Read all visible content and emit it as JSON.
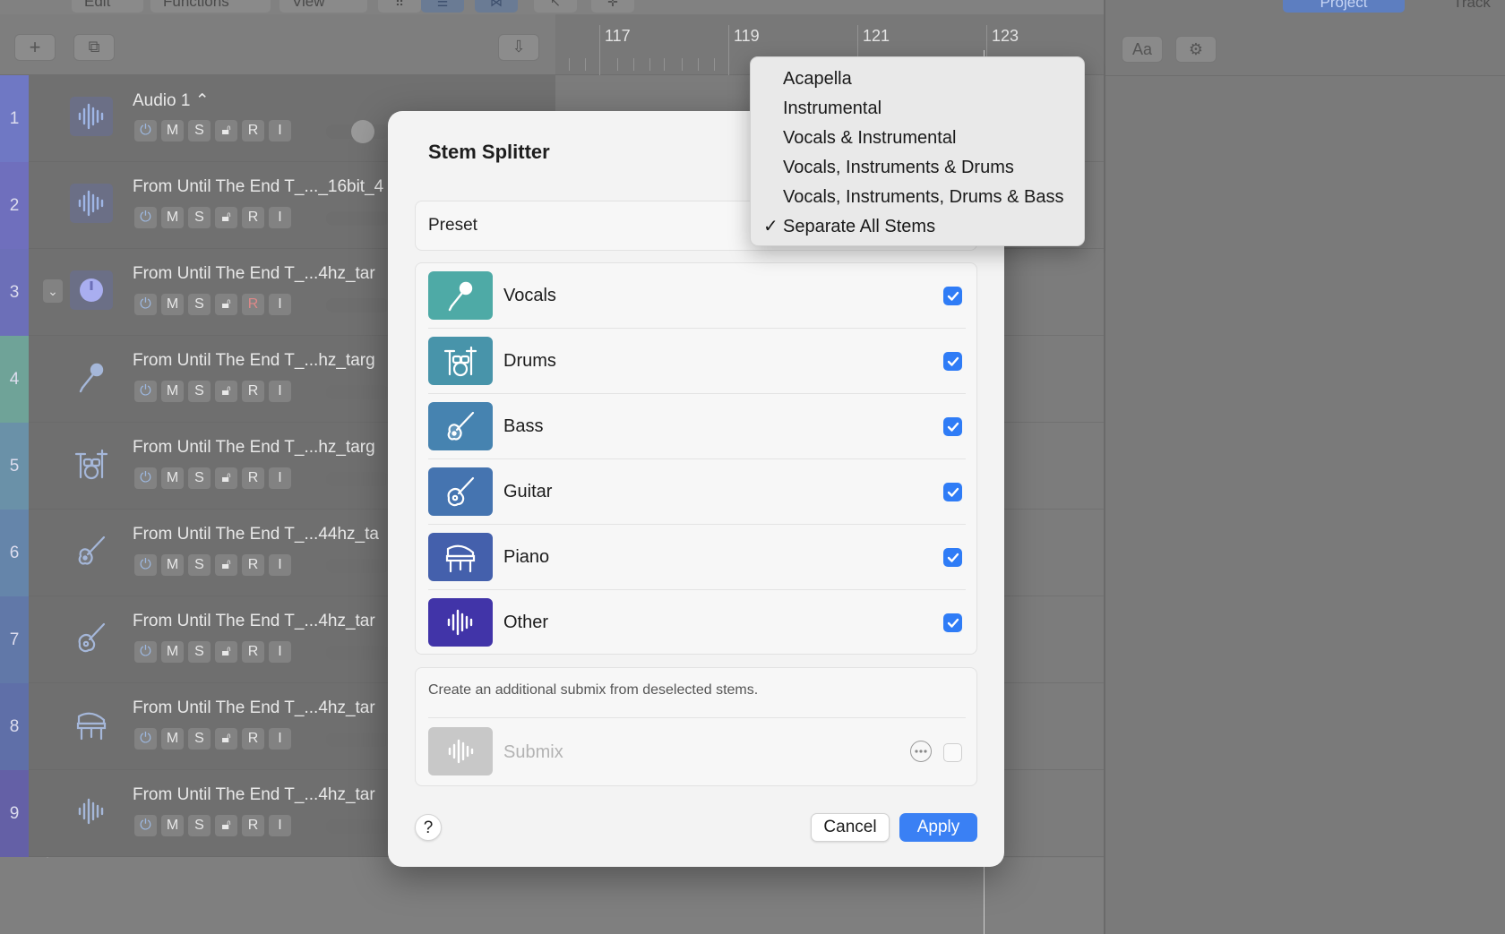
{
  "app": {
    "menubar": [
      "Edit",
      "Functions",
      "View"
    ],
    "ruler": [
      "117",
      "119",
      "121",
      "123"
    ],
    "sidebar_tabs": [
      "Project",
      "Track"
    ],
    "sidebar_font_button": "Aa",
    "tracks": [
      {
        "num": "1",
        "name": "Audio 1 ⌃",
        "color": "#6f78c4",
        "icon": "waveform-icon"
      },
      {
        "num": "2",
        "name": "From Until The End T_..._16bit_4",
        "color": "#6f6fbd",
        "icon": "waveform-icon"
      },
      {
        "num": "3",
        "name": "From Until The End T_...4hz_tar",
        "color": "#6c6fb8",
        "icon": "stem-splitter-icon"
      },
      {
        "num": "4",
        "name": "From Until The End T_...hz_targ",
        "color": "#6fa398",
        "icon": "microphone-icon"
      },
      {
        "num": "5",
        "name": "From Until The End T_...hz_targ",
        "color": "#6a91a8",
        "icon": "drums-icon"
      },
      {
        "num": "6",
        "name": "From Until The End T_...44hz_ta",
        "color": "#6585aa",
        "icon": "bass-guitar-icon"
      },
      {
        "num": "7",
        "name": "From Until The End T_...4hz_tar",
        "color": "#6178a8",
        "icon": "guitar-icon"
      },
      {
        "num": "8",
        "name": "From Until The End T_...4hz_tar",
        "color": "#5f6fa8",
        "icon": "piano-icon"
      },
      {
        "num": "9",
        "name": "From Until The End T_...4hz_tar",
        "color": "#6460a6",
        "icon": "waveform-icon"
      }
    ],
    "track_controls": [
      "M",
      "S",
      "R",
      "I"
    ]
  },
  "dialog": {
    "title": "Stem Splitter",
    "preset_label": "Preset",
    "stems": [
      {
        "label": "Vocals",
        "checked": true,
        "color": "#4eaaa6",
        "icon": "microphone-icon"
      },
      {
        "label": "Drums",
        "checked": true,
        "color": "#4894aa",
        "icon": "drums-icon"
      },
      {
        "label": "Bass",
        "checked": true,
        "color": "#4683b0",
        "icon": "bass-guitar-icon"
      },
      {
        "label": "Guitar",
        "checked": true,
        "color": "#4574b0",
        "icon": "guitar-icon"
      },
      {
        "label": "Piano",
        "checked": true,
        "color": "#4460ac",
        "icon": "piano-icon"
      },
      {
        "label": "Other",
        "checked": true,
        "color": "#4134a8",
        "icon": "waveform-icon"
      }
    ],
    "submix_note": "Create an additional submix from deselected stems.",
    "submix_label": "Submix",
    "submix_checked": false,
    "help_label": "?",
    "cancel_label": "Cancel",
    "apply_label": "Apply"
  },
  "preset_menu": {
    "items": [
      {
        "label": "Acapella",
        "selected": false
      },
      {
        "label": "Instrumental",
        "selected": false
      },
      {
        "label": "Vocals & Instrumental",
        "selected": false
      },
      {
        "label": "Vocals, Instruments & Drums",
        "selected": false
      },
      {
        "label": "Vocals, Instruments, Drums & Bass",
        "selected": false
      },
      {
        "label": "Separate All Stems",
        "selected": true
      }
    ],
    "check_glyph": "✓"
  }
}
